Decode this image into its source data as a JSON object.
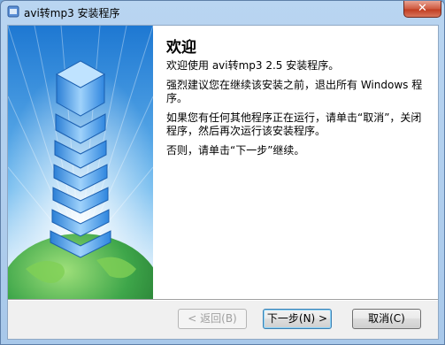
{
  "window": {
    "title": "avi转mp3 安装程序",
    "close_label": "✕"
  },
  "content": {
    "heading": "欢迎",
    "para1": "欢迎使用 avi转mp3 2.5 安装程序。",
    "para2": "强烈建议您在继续该安装之前，退出所有 Windows 程序。",
    "para3": "如果您有任何其他程序正在运行，请单击“取消”，关闭程序，然后再次运行该安装程序。",
    "para4": "否则，请单击“下一步”继续。"
  },
  "buttons": {
    "back": "< 返回(B)",
    "next": "下一步(N) >",
    "cancel": "取消(C)"
  }
}
